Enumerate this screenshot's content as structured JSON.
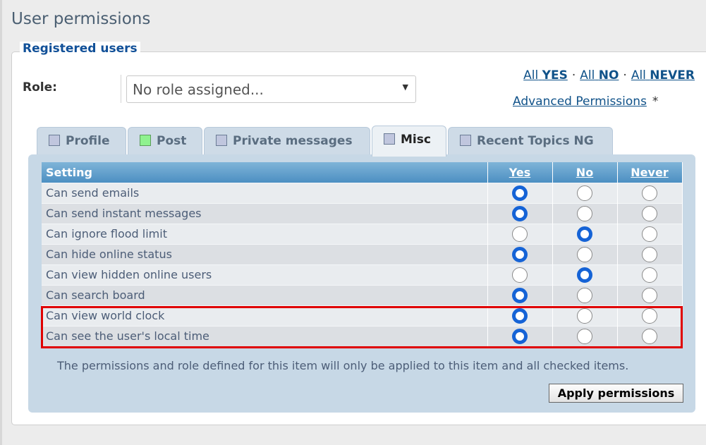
{
  "page": {
    "title": "User permissions"
  },
  "group": {
    "legend": "Registered users"
  },
  "role": {
    "label": "Role:",
    "selected": "No role assigned..."
  },
  "quick_links": {
    "all_yes_prefix": "All",
    "all_yes": "YES",
    "all_no_prefix": "All",
    "all_no": "NO",
    "all_never_prefix": "All",
    "all_never": "NEVER",
    "separator": "·",
    "advanced": "Advanced Permissions",
    "advanced_marker": "*"
  },
  "tabs": [
    {
      "label": "Profile",
      "icon": "square-icon"
    },
    {
      "label": "Post",
      "icon": "square-icon"
    },
    {
      "label": "Private messages",
      "icon": "square-icon"
    },
    {
      "label": "Misc",
      "icon": "square-icon",
      "active": true
    },
    {
      "label": "Recent Topics NG",
      "icon": "square-icon"
    }
  ],
  "table": {
    "headers": {
      "setting": "Setting",
      "yes": "Yes",
      "no": "No",
      "never": "Never"
    },
    "rows": [
      {
        "label": "Can send emails",
        "value": "yes"
      },
      {
        "label": "Can send instant messages",
        "value": "yes"
      },
      {
        "label": "Can ignore flood limit",
        "value": "no"
      },
      {
        "label": "Can hide online status",
        "value": "yes"
      },
      {
        "label": "Can view hidden online users",
        "value": "no"
      },
      {
        "label": "Can search board",
        "value": "yes"
      },
      {
        "label": "Can view world clock",
        "value": "yes"
      },
      {
        "label": "Can see the user's local time",
        "value": "yes"
      }
    ]
  },
  "note": "The permissions and role defined for this item will only be applied to this item and all checked items.",
  "apply_label": "Apply permissions",
  "colors": {
    "radio_selected": "#1563d6",
    "highlight": "#e00000",
    "link": "#105289"
  }
}
